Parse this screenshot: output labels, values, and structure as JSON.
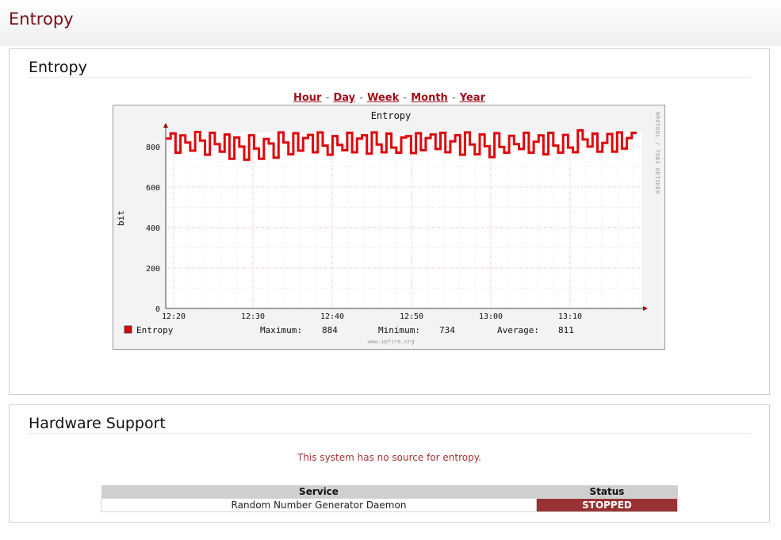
{
  "page": {
    "title": "Entropy"
  },
  "entropy_panel": {
    "heading": "Entropy",
    "links": [
      "Hour",
      "Day",
      "Week",
      "Month",
      "Year"
    ],
    "link_separator": "-"
  },
  "chart_data": {
    "type": "line",
    "title": "Entropy",
    "ylabel": "bit",
    "xlabel": "",
    "ylim": [
      0,
      900
    ],
    "y_ticks": [
      0,
      200,
      400,
      600,
      800
    ],
    "x_ticks": [
      "12:20",
      "12:30",
      "12:40",
      "12:50",
      "13:00",
      "13:10"
    ],
    "grid": true,
    "watermark_side": "RRDTOOL / TOBI OETIKER",
    "watermark_bottom": "www.ipfire.org",
    "color": "#e0060b",
    "series": [
      {
        "name": "Entropy",
        "values": [
          840,
          865,
          770,
          855,
          820,
          780,
          872,
          830,
          760,
          868,
          812,
          775,
          860,
          740,
          845,
          800,
          735,
          856,
          790,
          740,
          838,
          815,
          745,
          870,
          820,
          762,
          866,
          780,
          842,
          858,
          772,
          870,
          805,
          760,
          852,
          808,
          782,
          868,
          772,
          840,
          856,
          765,
          870,
          810,
          772,
          864,
          795,
          770,
          845,
          852,
          768,
          866,
          782,
          842,
          860,
          788,
          868,
          772,
          826,
          856,
          760,
          870,
          810,
          762,
          860,
          802,
          748,
          866,
          798,
          770,
          853,
          812,
          788,
          868,
          770,
          824,
          855,
          762,
          868,
          805,
          770,
          858,
          795,
          772,
          880,
          835,
          800,
          864,
          775,
          818,
          862,
          775,
          870,
          790,
          842,
          868
        ]
      }
    ],
    "legend": [
      {
        "label": "Maximum:",
        "value": "884"
      },
      {
        "label": "Minimum:",
        "value": "734"
      },
      {
        "label": "Average:",
        "value": "811"
      }
    ]
  },
  "hardware_panel": {
    "heading": "Hardware Support",
    "message": "This system has no source for entropy.",
    "table": {
      "headers": [
        "Service",
        "Status"
      ],
      "rows": [
        {
          "service": "Random Number Generator Daemon",
          "status": "STOPPED"
        }
      ]
    },
    "status_color": "#993333"
  }
}
